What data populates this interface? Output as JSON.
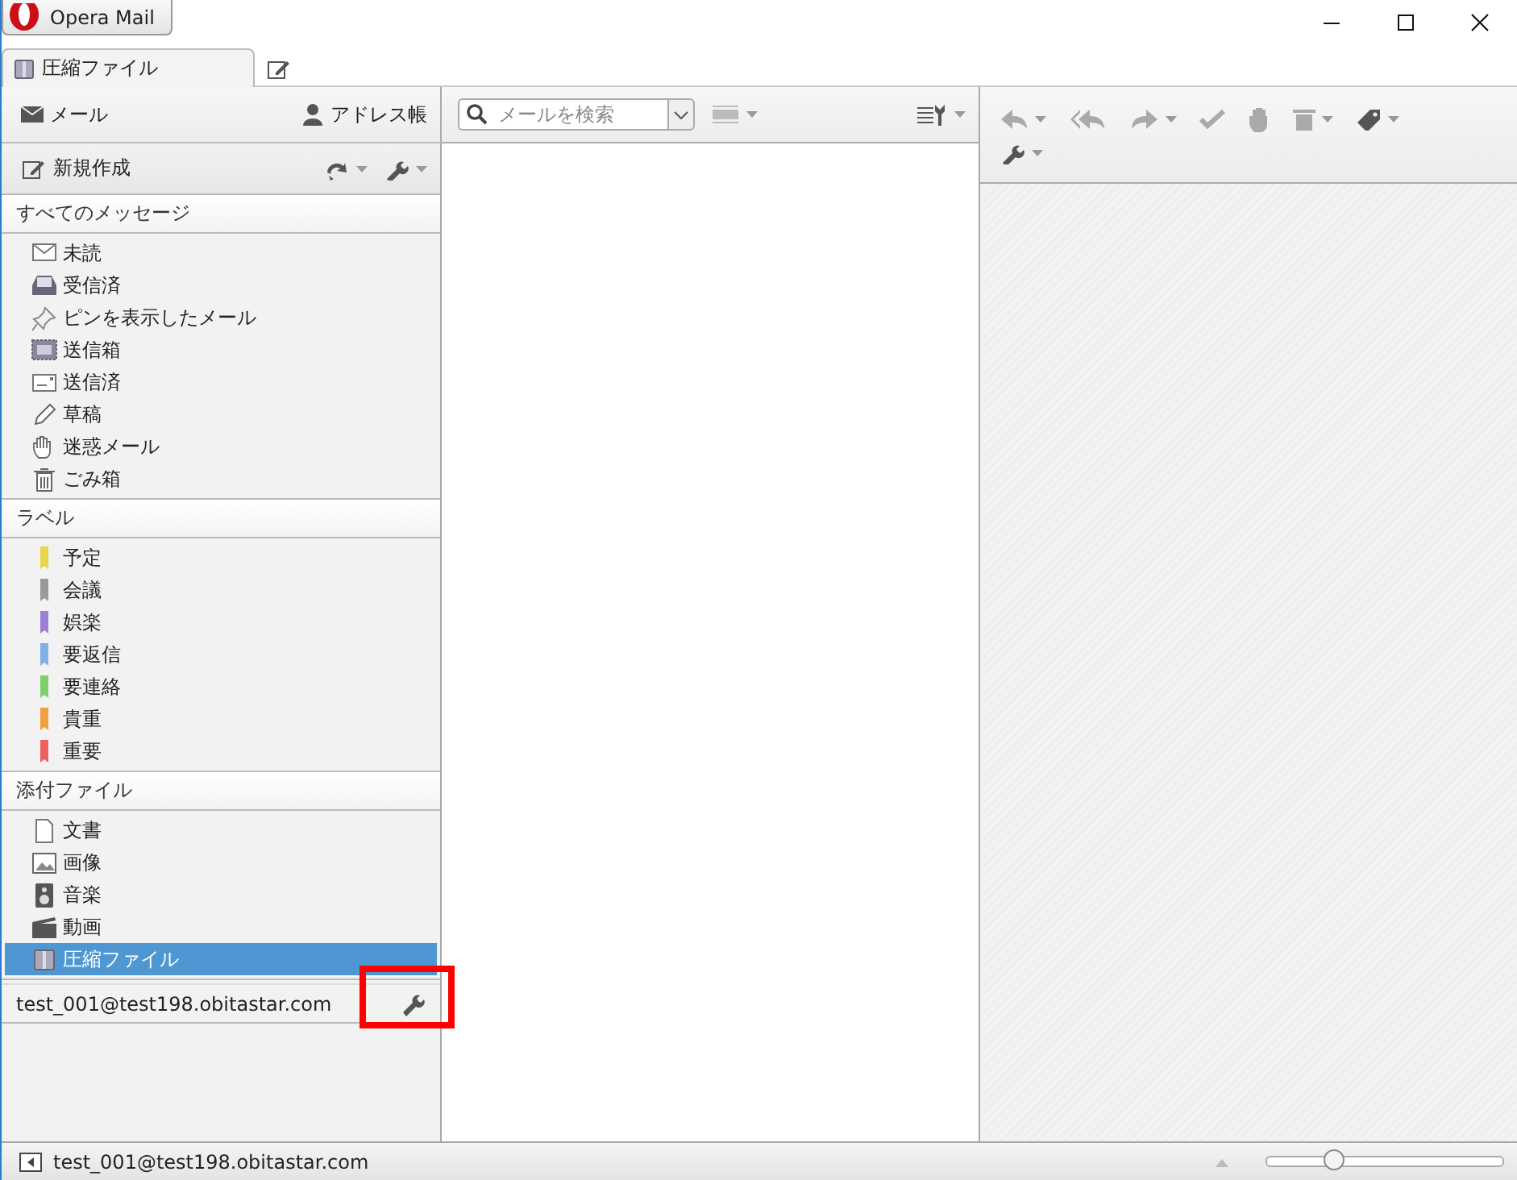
{
  "window": {
    "title": "Opera Mail"
  },
  "tabs": [
    {
      "label": "圧縮ファイル",
      "selected": true
    },
    {
      "kind": "compose",
      "selected": false
    }
  ],
  "sidebar": {
    "mail_label": "メール",
    "contacts_label": "アドレス帳",
    "compose_label": "新規作成",
    "sections": [
      {
        "title": "すべてのメッセージ",
        "items": [
          {
            "label": "未読",
            "selected": false
          },
          {
            "label": "受信済",
            "selected": false
          },
          {
            "label": "ピンを表示したメール",
            "selected": false
          },
          {
            "label": "送信箱",
            "selected": false
          },
          {
            "label": "送信済",
            "selected": false
          },
          {
            "label": "草稿",
            "selected": false
          },
          {
            "label": "迷惑メール",
            "selected": false
          },
          {
            "label": "ごみ箱",
            "selected": false
          }
        ]
      },
      {
        "title": "ラベル",
        "items": [
          {
            "label": "予定",
            "selected": false,
            "color": "#e8d44a"
          },
          {
            "label": "会議",
            "selected": false,
            "color": "#9a9a9a"
          },
          {
            "label": "娯楽",
            "selected": false,
            "color": "#9b7fd6"
          },
          {
            "label": "要返信",
            "selected": false,
            "color": "#7fb0ea"
          },
          {
            "label": "要連絡",
            "selected": false,
            "color": "#7dd06a"
          },
          {
            "label": "貴重",
            "selected": false,
            "color": "#f0a040"
          },
          {
            "label": "重要",
            "selected": false,
            "color": "#ee6060"
          }
        ]
      },
      {
        "title": "添付ファイル",
        "items": [
          {
            "label": "文書",
            "selected": false
          },
          {
            "label": "画像",
            "selected": false
          },
          {
            "label": "音楽",
            "selected": false
          },
          {
            "label": "動画",
            "selected": false
          },
          {
            "label": "圧縮ファイル",
            "selected": true
          }
        ]
      }
    ],
    "account": "test_001@test198.obitastar.com"
  },
  "search": {
    "placeholder": "メールを検索"
  },
  "highlight_box": true,
  "status_bar": {
    "account": "test_001@test198.obitastar.com",
    "zoom": {
      "level": 0.28
    }
  }
}
